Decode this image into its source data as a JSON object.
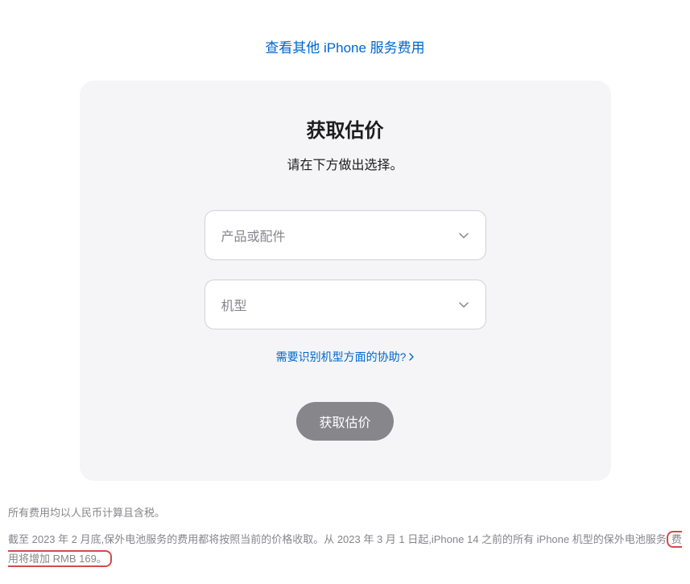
{
  "topLink": {
    "label": "查看其他 iPhone 服务费用"
  },
  "card": {
    "title": "获取估价",
    "subtitle": "请在下方做出选择。",
    "select1": {
      "placeholder": "产品或配件"
    },
    "select2": {
      "placeholder": "机型"
    },
    "helpLink": {
      "label": "需要识别机型方面的协助?"
    },
    "button": {
      "label": "获取估价"
    }
  },
  "footer": {
    "line1": "所有费用均以人民币计算且含税。",
    "line2_part1": "截至 2023 年 2 月底,保外电池服务的费用都将按照当前的价格收取。从 2023 年 3 月 1 日起,iPhone 14 之前的所有 iPhone 机型的保外电池服务",
    "line2_highlight": "费用将增加 RMB 169。"
  }
}
